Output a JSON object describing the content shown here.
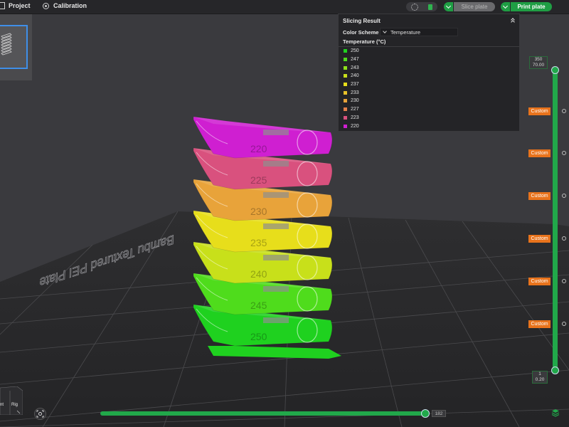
{
  "topbar": {
    "project_label": "Project",
    "calibration_label": "Calibration",
    "slice_label": "Slice plate",
    "print_label": "Print plate"
  },
  "panel": {
    "title": "Slicing Result",
    "scheme_label": "Color Scheme",
    "scheme_value": "Temperature",
    "legend_header": "Temperature (°C)",
    "legend": [
      {
        "label": "250",
        "color": "#1fd11f"
      },
      {
        "label": "247",
        "color": "#4fdc1c"
      },
      {
        "label": "243",
        "color": "#8ee01a"
      },
      {
        "label": "240",
        "color": "#c8e01a"
      },
      {
        "label": "237",
        "color": "#e7de1b"
      },
      {
        "label": "233",
        "color": "#e8c128"
      },
      {
        "label": "230",
        "color": "#e8a33a"
      },
      {
        "label": "227",
        "color": "#e4814a"
      },
      {
        "label": "223",
        "color": "#d9517e"
      },
      {
        "label": "220",
        "color": "#cf1fd1"
      }
    ]
  },
  "layer_slider": {
    "top_layer": "350",
    "top_height": "70.00",
    "bottom_layer": "1",
    "bottom_height": "0.20",
    "custom_tags": [
      "Custom",
      "Custom",
      "Custom",
      "Custom",
      "Custom",
      "Custom"
    ]
  },
  "move_slider": {
    "value": "182"
  },
  "bed_text": "Bambu Textured PEI Plate",
  "tower_labels": [
    "250",
    "245",
    "240",
    "235",
    "230",
    "225",
    "220"
  ],
  "navcube": {
    "left_label": "nt",
    "right_label": "Rig"
  }
}
